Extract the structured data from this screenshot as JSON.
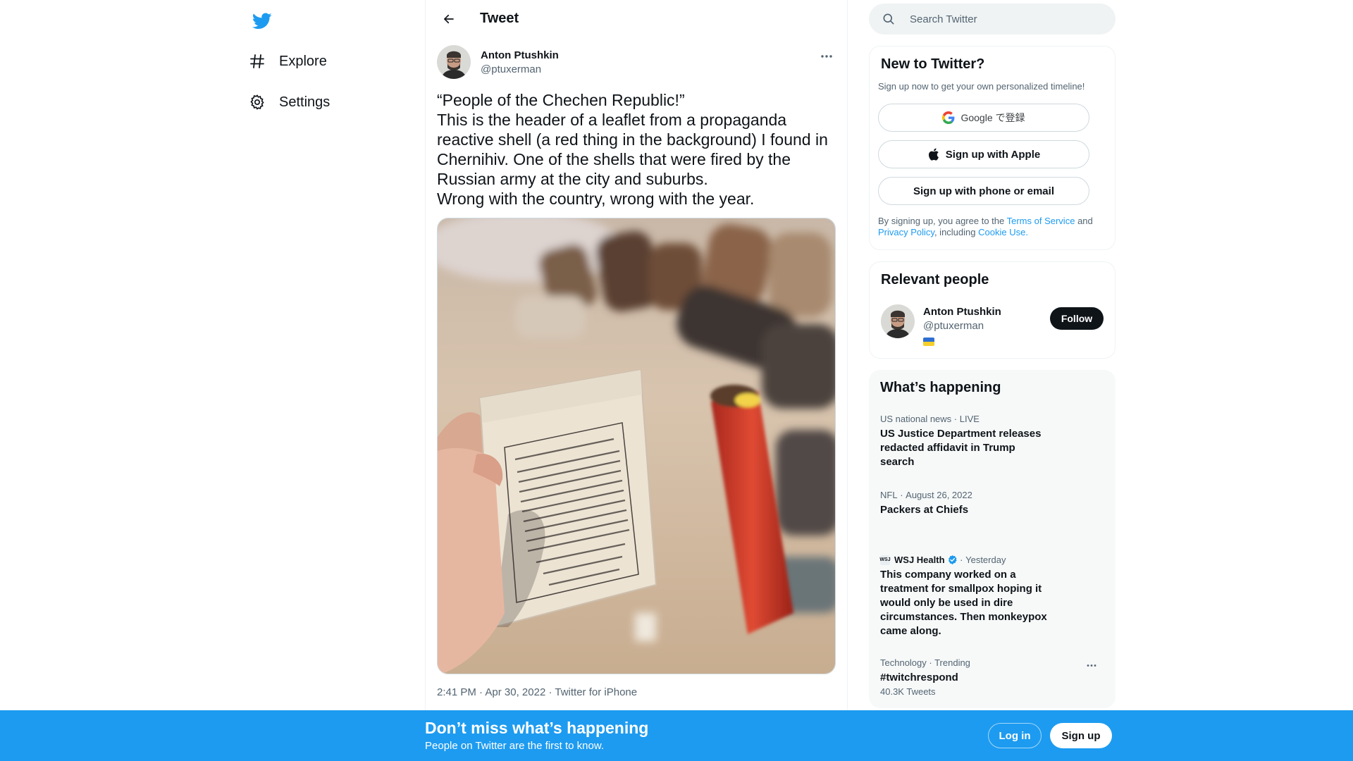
{
  "colors": {
    "brand": "#1d9bf0",
    "text": "#0f1419",
    "secondary": "#536471",
    "bottom_bar": "#1d9bf0"
  },
  "nav": {
    "logo_icon": "twitter-bird-icon",
    "items": [
      {
        "label": "Explore",
        "icon": "hashtag-icon"
      },
      {
        "label": "Settings",
        "icon": "gear-icon"
      }
    ]
  },
  "header": {
    "title": "Tweet",
    "back_icon": "arrow-left-icon"
  },
  "tweet": {
    "author_name": "Anton Ptushkin",
    "author_handle": "@ptuxerman",
    "lines": [
      "“People of the Chechen Republic!”",
      "This is the header of a leaflet from a propaganda reactive shell (a red thing in the background) I found in Chernihiv. One of the shells that were fired by the Russian army at the city and suburbs.",
      "Wrong with the country, wrong with the year."
    ],
    "time": "2:41 PM",
    "date": "Apr 30, 2022",
    "source": "Twitter for iPhone",
    "separator": "·"
  },
  "search": {
    "placeholder": "Search Twitter"
  },
  "new_to_twitter": {
    "title": "New to Twitter?",
    "subtitle": "Sign up now to get your own personalized timeline!",
    "google_label": "Google で登録",
    "apple_label": "Sign up with Apple",
    "phone_label": "Sign up with phone or email",
    "legal_prefix": "By signing up, you agree to the",
    "terms_link": "Terms of Service",
    "legal_and": "and",
    "privacy_link": "Privacy Policy",
    "legal_including": ", including",
    "cookie_link": "Cookie Use."
  },
  "relevant_people": {
    "title": "Relevant people",
    "name": "Anton Ptushkin",
    "handle": "@ptuxerman",
    "follow_label": "Follow"
  },
  "happening": {
    "title": "What’s happening",
    "trends": [
      {
        "context": "US national news",
        "sep": "·",
        "status": "LIVE",
        "title": "US Justice Department releases redacted affidavit in Trump search"
      },
      {
        "context": "NFL",
        "sep": "·",
        "status": "August 26, 2022",
        "title": "Packers at Chiefs"
      },
      {
        "source": "WSJ Health",
        "sep": "·",
        "status": "Yesterday",
        "title": "This company worked on a treatment for smallpox hoping it would only be used in dire circumstances. Then monkeypox came along."
      },
      {
        "context": "Technology · Trending",
        "title": "#twitchrespond",
        "count": "40.3K Tweets"
      }
    ]
  },
  "bottom_bar": {
    "title": "Don’t miss what’s happening",
    "subtitle": "People on Twitter are the first to know.",
    "login_label": "Log in",
    "signup_label": "Sign up"
  }
}
